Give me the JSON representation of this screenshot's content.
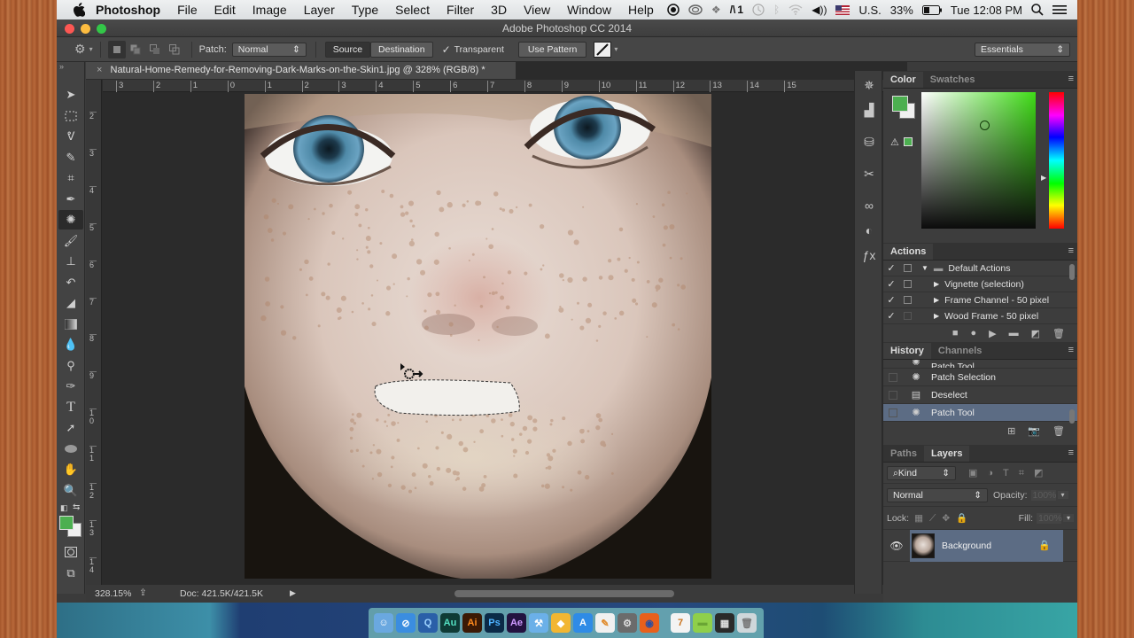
{
  "menubar": {
    "app_name": "Photoshop",
    "items": [
      "File",
      "Edit",
      "Image",
      "Layer",
      "Type",
      "Select",
      "Filter",
      "3D",
      "View",
      "Window",
      "Help"
    ],
    "status_icons": [
      "record-icon",
      "creative-cloud-icon",
      "dropbox-icon",
      "adobe-icon",
      "time-machine-icon",
      "bluetooth-icon",
      "wifi-icon",
      "volume-icon"
    ],
    "adobe_badge": "1",
    "input_source": "U.S.",
    "battery": "33%",
    "clock": "Tue 12:08 PM"
  },
  "window": {
    "title": "Adobe Photoshop CC 2014"
  },
  "options_bar": {
    "patch_label": "Patch:",
    "patch_mode": "Normal",
    "source_label": "Source",
    "destination_label": "Destination",
    "transparent_label": "Transparent",
    "transparent_checked": true,
    "use_pattern_label": "Use Pattern",
    "workspace": "Essentials"
  },
  "document": {
    "tab_title": "Natural-Home-Remedy-for-Removing-Dark-Marks-on-the-Skin1.jpg @ 328% (RGB/8) *",
    "h_ruler": [
      "3",
      "2",
      "1",
      "0",
      "1",
      "2",
      "3",
      "4",
      "5",
      "6",
      "7",
      "8",
      "9",
      "10",
      "11",
      "12",
      "13",
      "14",
      "15"
    ],
    "v_ruler": [
      "2",
      "3",
      "4",
      "5",
      "6",
      "7",
      "8",
      "9",
      "10",
      "11",
      "12",
      "13",
      "14"
    ],
    "zoom": "328.15%",
    "doc_size": "Doc: 421.5K/421.5K"
  },
  "tools": [
    "move",
    "marquee",
    "lasso",
    "quick-selection",
    "crop",
    "eyedropper",
    "patch",
    "brush",
    "clone-stamp",
    "history-brush",
    "eraser",
    "gradient",
    "blur",
    "dodge",
    "pen",
    "type",
    "path-selection",
    "ellipse",
    "hand",
    "zoom"
  ],
  "colors": {
    "foreground": "#4caf50",
    "background": "#f0f0f0",
    "accent_selection": "#5c6c84"
  },
  "color_panel": {
    "tabs": [
      "Color",
      "Swatches"
    ]
  },
  "actions_panel": {
    "title": "Actions",
    "items": [
      {
        "label": "Default Actions",
        "type": "set",
        "checked": true
      },
      {
        "label": "Vignette (selection)",
        "type": "action",
        "checked": true
      },
      {
        "label": "Frame Channel - 50 pixel",
        "type": "action",
        "checked": true
      },
      {
        "label": "Wood Frame - 50 pixel",
        "type": "action",
        "checked": true
      }
    ]
  },
  "history_panel": {
    "tabs": [
      "History",
      "Channels"
    ],
    "items": [
      {
        "label": "Patch Tool",
        "selected": false,
        "partial": true
      },
      {
        "label": "Patch Selection",
        "selected": false
      },
      {
        "label": "Deselect",
        "selected": false
      },
      {
        "label": "Patch Tool",
        "selected": true
      }
    ]
  },
  "layers_panel": {
    "tabs": [
      "Paths",
      "Layers"
    ],
    "filter": "Kind",
    "blend_mode": "Normal",
    "opacity_label": "Opacity:",
    "opacity": "100%",
    "lock_label": "Lock:",
    "fill_label": "Fill:",
    "fill": "100%",
    "layers": [
      {
        "name": "Background",
        "visible": true,
        "locked": true
      }
    ]
  },
  "dock": {
    "apps": [
      {
        "name": "Finder",
        "glyph": "☺",
        "bg": "#6aa8e0",
        "fg": "#fff"
      },
      {
        "name": "Safari",
        "glyph": "⊘",
        "bg": "#3b8de0",
        "fg": "#fff"
      },
      {
        "name": "QuickTime",
        "glyph": "Q",
        "bg": "#2a5fa8",
        "fg": "#9fd3ff"
      },
      {
        "name": "Audition",
        "glyph": "Au",
        "bg": "#0f3b36",
        "fg": "#55e0c2"
      },
      {
        "name": "Illustrator",
        "glyph": "Ai",
        "bg": "#3b1905",
        "fg": "#ff8a1f"
      },
      {
        "name": "Photoshop",
        "glyph": "Ps",
        "bg": "#0b2a47",
        "fg": "#4fb3ff"
      },
      {
        "name": "After Effects",
        "glyph": "Ae",
        "bg": "#23123f",
        "fg": "#cf9bff"
      },
      {
        "name": "Xcode",
        "glyph": "⚒",
        "bg": "#6bb0e8",
        "fg": "#fff"
      },
      {
        "name": "Sketch",
        "glyph": "◆",
        "bg": "#f2b632",
        "fg": "#fff"
      },
      {
        "name": "App Store",
        "glyph": "A",
        "bg": "#2f8be6",
        "fg": "#fff"
      },
      {
        "name": "Pages",
        "glyph": "✎",
        "bg": "#f0f0f0",
        "fg": "#e08a2a"
      },
      {
        "name": "System Preferences",
        "glyph": "⚙",
        "bg": "#6b6b6b",
        "fg": "#ddd"
      },
      {
        "name": "Firefox",
        "glyph": "◉",
        "bg": "#e8601c",
        "fg": "#2a4ea0"
      },
      {
        "name": "TextEdit",
        "glyph": "7",
        "bg": "#f3f3f3",
        "fg": "#c9731e"
      },
      {
        "name": "Folder",
        "glyph": "▬",
        "bg": "#8fcf4a",
        "fg": "#6aa534"
      },
      {
        "name": "Screen",
        "glyph": "▦",
        "bg": "#2a2a2a",
        "fg": "#ddd"
      },
      {
        "name": "Trash",
        "glyph": "🗑",
        "bg": "#cfd7da",
        "fg": "#777"
      }
    ]
  }
}
